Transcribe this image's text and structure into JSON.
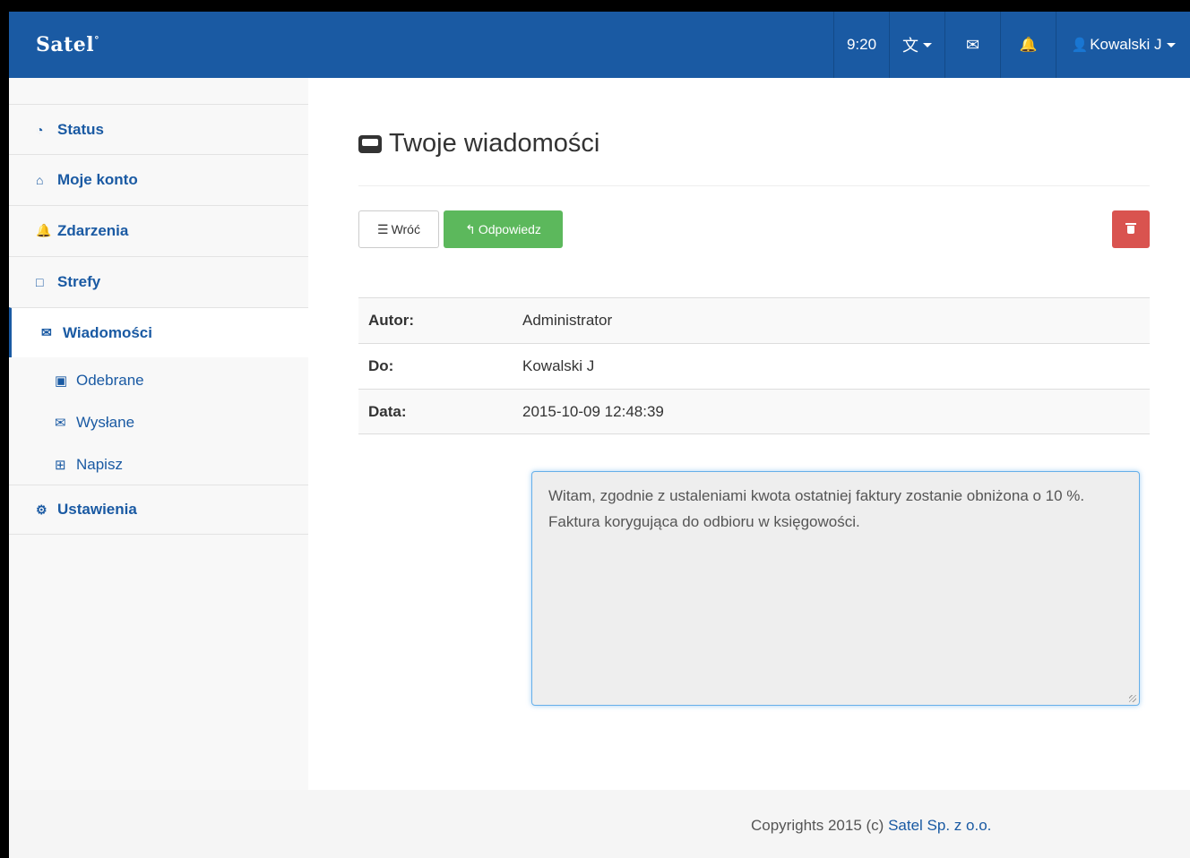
{
  "brand": {
    "name": "Satel",
    "mark": "°"
  },
  "navbar": {
    "time": "9:20",
    "language_icon": "language-icon",
    "messages_icon": "envelope-icon",
    "notifications_icon": "bell-icon",
    "user_name": "Kowalski J"
  },
  "sidebar": {
    "items": [
      {
        "label": "Status",
        "icon": "dashboard-icon"
      },
      {
        "label": "Moje konto",
        "icon": "home-icon"
      },
      {
        "label": "Zdarzenia",
        "icon": "bell-icon"
      },
      {
        "label": "Strefy",
        "icon": "square-icon"
      },
      {
        "label": "Wiadomości",
        "icon": "envelope-icon",
        "active": true
      },
      {
        "label": "Ustawienia",
        "icon": "cogs-icon"
      }
    ],
    "subitems": [
      {
        "label": "Odebrane",
        "icon": "inbox-icon"
      },
      {
        "label": "Wysłane",
        "icon": "envelope-outline-icon"
      },
      {
        "label": "Napisz",
        "icon": "plus-square-icon"
      }
    ]
  },
  "main": {
    "title": "Twoje wiadomości",
    "back_label": "Wróć",
    "reply_label": "Odpowiedz",
    "details": [
      {
        "label": "Autor:",
        "value": "Administrator"
      },
      {
        "label": "Do:",
        "value": "Kowalski J"
      },
      {
        "label": "Data:",
        "value": "2015-10-09 12:48:39"
      }
    ],
    "message": "Witam, zgodnie z ustaleniami kwota ostatniej faktury zostanie obniżona o 10 %. Faktura korygująca do odbioru w księgowości."
  },
  "footer": {
    "text": "Copyrights 2015 (c) ",
    "link": "Satel Sp. z o.o."
  },
  "colors": {
    "primary": "#1a5aa3",
    "success": "#5cb85c",
    "danger": "#d9534f"
  }
}
